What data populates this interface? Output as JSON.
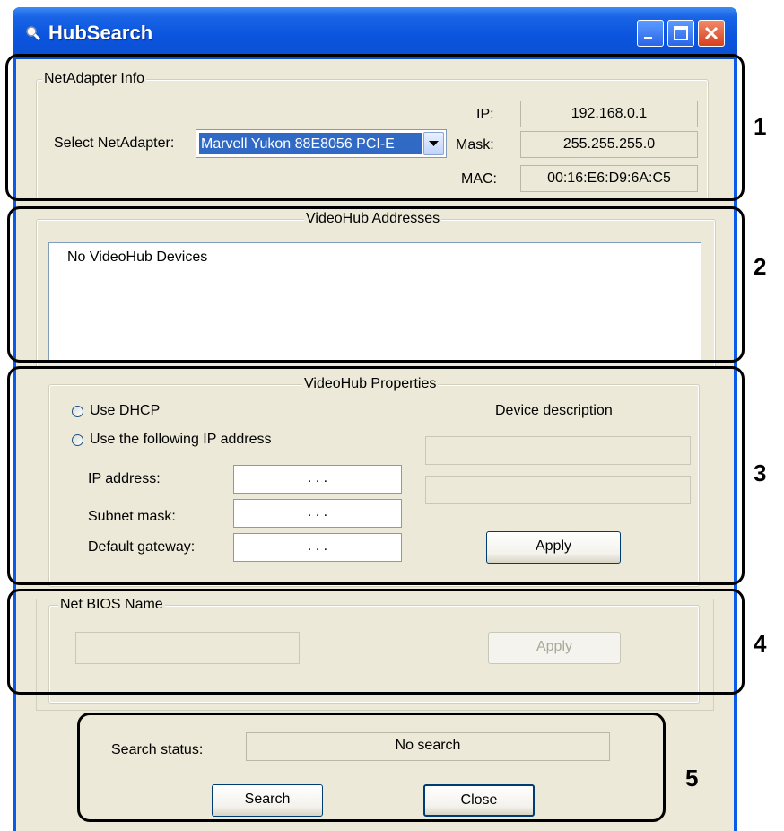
{
  "window": {
    "title": "HubSearch"
  },
  "netadapter": {
    "group_label": "NetAdapter Info",
    "select_label": "Select NetAdapter:",
    "selected": "Marvell Yukon 88E8056 PCI-E",
    "ip_label": "IP:",
    "ip_value": "192.168.0.1",
    "mask_label": "Mask:",
    "mask_value": "255.255.255.0",
    "mac_label": "MAC:",
    "mac_value": "00:16:E6:D9:6A:C5"
  },
  "addresses": {
    "group_label": "VideoHub Addresses",
    "items": [
      "No VideoHub Devices"
    ]
  },
  "properties": {
    "group_label": "VideoHub Properties",
    "dhcp_label": "Use DHCP",
    "static_label": "Use the following IP address",
    "ip_label": "IP address:",
    "subnet_label": "Subnet mask:",
    "gateway_label": "Default gateway:",
    "ip_value": " .   .   . ",
    "subnet_value": " .   .   . ",
    "gateway_value": " .   .   . ",
    "device_desc_label": "Device description",
    "apply_label": "Apply"
  },
  "netbios": {
    "group_label": "Net BIOS Name",
    "apply_label": "Apply"
  },
  "status": {
    "label": "Search status:",
    "value": "No search",
    "search_label": "Search",
    "close_label": "Close"
  },
  "callouts": [
    "1",
    "2",
    "3",
    "4",
    "5"
  ],
  "colors": {
    "titlebar": "#0b55df",
    "client": "#ece9d8",
    "selection": "#316ac5",
    "close_button": "#d6401e"
  }
}
